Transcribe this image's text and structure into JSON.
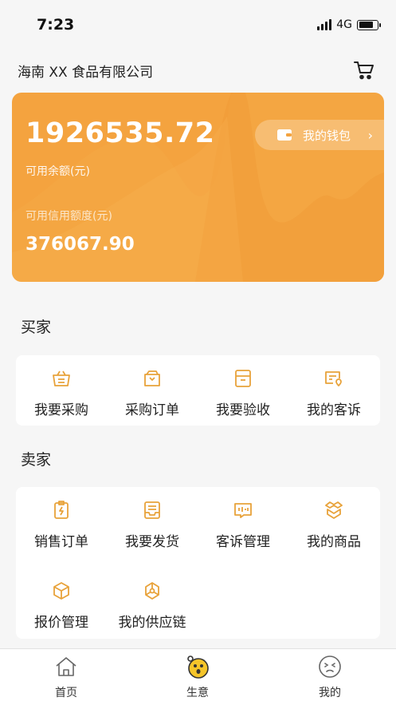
{
  "status_bar": {
    "time": "7:23",
    "network": "4G",
    "battery_level": 0.8
  },
  "header": {
    "company": "海南 XX 食品有限公司",
    "cart_icon": "cart-icon"
  },
  "wallet": {
    "balance": "1926535.72",
    "balance_label": "可用余额(元)",
    "credit_label": "可用信用额度(元)",
    "credit": "376067.90",
    "button_label": "我的钱包",
    "chevron": "›",
    "accent": "#f4a33f"
  },
  "buyer": {
    "title": "买家",
    "items": [
      {
        "label": "我要采购",
        "icon": "basket-icon"
      },
      {
        "label": "采购订单",
        "icon": "order-box-icon"
      },
      {
        "label": "我要验收",
        "icon": "inspect-box-icon"
      },
      {
        "label": "我的客诉",
        "icon": "complaint-icon"
      }
    ]
  },
  "seller": {
    "title": "卖家",
    "items": [
      {
        "label": "销售订单",
        "icon": "sales-order-icon"
      },
      {
        "label": "我要发货",
        "icon": "ship-icon"
      },
      {
        "label": "客诉管理",
        "icon": "complaint-manage-icon"
      },
      {
        "label": "我的商品",
        "icon": "product-icon"
      },
      {
        "label": "报价管理",
        "icon": "quote-cube-icon"
      },
      {
        "label": "我的供应链",
        "icon": "supply-chain-icon"
      }
    ]
  },
  "tabbar": [
    {
      "label": "首页",
      "icon": "home-icon"
    },
    {
      "label": "生意",
      "icon": "business-icon",
      "active": true
    },
    {
      "label": "我的",
      "icon": "profile-icon"
    }
  ],
  "icon_color": "#e8a23a"
}
